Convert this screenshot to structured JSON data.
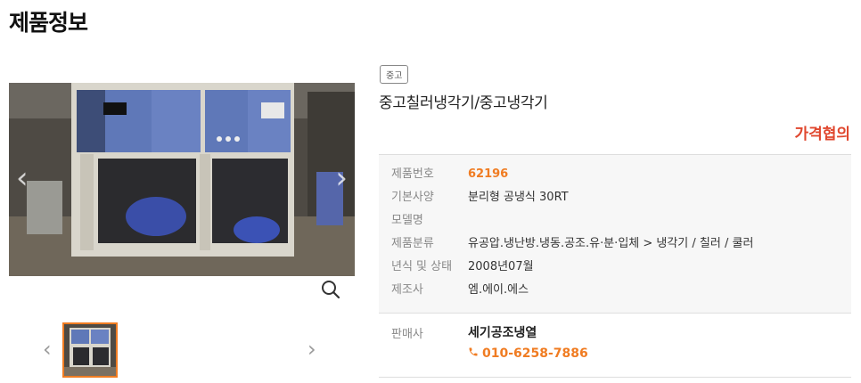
{
  "page": {
    "title": "제품정보"
  },
  "gallery": {
    "prev_glyph": "‹",
    "next_glyph": "›",
    "thumb_prev_glyph": "‹",
    "thumb_next_glyph": "›"
  },
  "product": {
    "badge": "중고",
    "title": "중고칠러냉각기/중고냉각기",
    "price": "가격협의"
  },
  "specs": [
    {
      "label": "제품번호",
      "value": "62196"
    },
    {
      "label": "기본사양",
      "value": "분리형 공냉식 30RT"
    },
    {
      "label": "모델명",
      "value": ""
    },
    {
      "label": "제품분류",
      "value": "유공압.냉난방.냉동.공조.유·분·입체 > 냉각기 / 칠러 / 쿨러"
    },
    {
      "label": "년식 및 상태",
      "value": "2008년07월"
    },
    {
      "label": "제조사",
      "value": "엠.에이.에스"
    }
  ],
  "seller": {
    "label": "판매사",
    "name": "세기공조냉열",
    "phone": "010-6258-7886"
  },
  "colors": {
    "accent": "#f07c22",
    "price": "#e0472e"
  },
  "icons": [
    "chevron-left-icon",
    "chevron-right-icon",
    "magnifier-icon",
    "phone-icon"
  ]
}
